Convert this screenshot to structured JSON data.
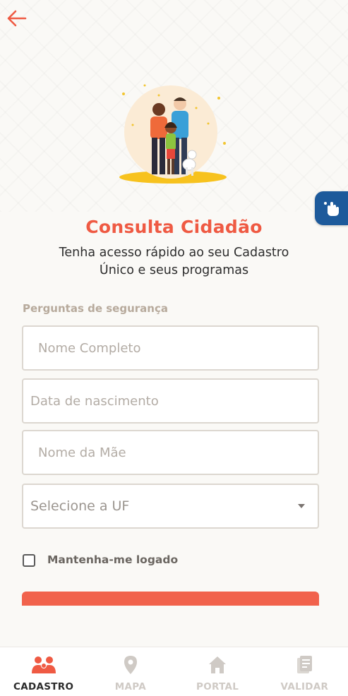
{
  "header": {
    "back_icon": "arrow-left-icon"
  },
  "hero": {
    "illustration": "family-with-dog-illustration"
  },
  "accessibility": {
    "icon": "accessibility-hand-icon",
    "color": "#1d5a9b"
  },
  "page": {
    "title": "Consulta Cidadão",
    "subtitle_lines": [
      "Tenha acesso rápido ao seu Cadastro",
      "Único e seus programas"
    ]
  },
  "form": {
    "section_label": "Perguntas de segurança",
    "full_name": {
      "value": "",
      "placeholder": "Nome Completo"
    },
    "birth_date": {
      "value": "",
      "placeholder": "Data de nascimento"
    },
    "mother_name": {
      "value": "",
      "placeholder": "Nome da Mãe"
    },
    "uf_select": {
      "selected": "Selecione a UF",
      "icon": "caret-down-icon"
    },
    "remember": {
      "label": "Mantenha-me logado",
      "checked": false
    }
  },
  "colors": {
    "accent": "#ef5a43",
    "button": "#f1624c",
    "text": "#2d2d2d"
  },
  "tabs": [
    {
      "label": "CADASTRO",
      "icon": "people-group-icon",
      "active": true
    },
    {
      "label": "MAPA",
      "icon": "map-pin-icon",
      "active": false
    },
    {
      "label": "PORTAL",
      "icon": "home-icon",
      "active": false
    },
    {
      "label": "VALIDAR",
      "icon": "document-check-icon",
      "active": false
    }
  ]
}
